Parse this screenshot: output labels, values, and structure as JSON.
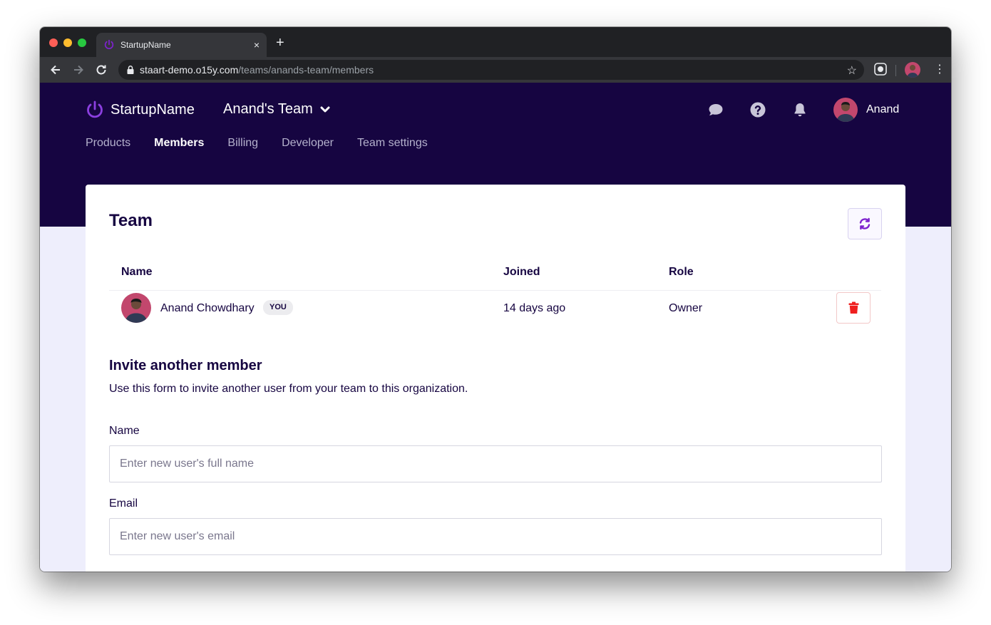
{
  "browser": {
    "tab_title": "StartupName",
    "tab_close": "×",
    "new_tab": "+",
    "url_host": "staart-demo.o15y.com",
    "url_path": "/teams/anands-team/members"
  },
  "header": {
    "brand_name": "StartupName",
    "team_name": "Anand's Team",
    "user_name": "Anand",
    "nav": {
      "products": "Products",
      "members": "Members",
      "billing": "Billing",
      "developer": "Developer",
      "team_settings": "Team settings"
    },
    "active_nav": "members"
  },
  "team": {
    "title": "Team",
    "columns": {
      "name": "Name",
      "joined": "Joined",
      "role": "Role"
    },
    "members": [
      {
        "name": "Anand Chowdhary",
        "badge": "YOU",
        "joined": "14 days ago",
        "role": "Owner"
      }
    ]
  },
  "invite": {
    "title": "Invite another member",
    "description": "Use this form to invite another user from your team to this organization.",
    "name_label": "Name",
    "name_placeholder": "Enter new user's full name",
    "email_label": "Email",
    "email_placeholder": "Enter new user's email"
  },
  "colors": {
    "header_bg": "#160541",
    "accent": "#7e22ce",
    "danger": "#ef1f1f"
  }
}
